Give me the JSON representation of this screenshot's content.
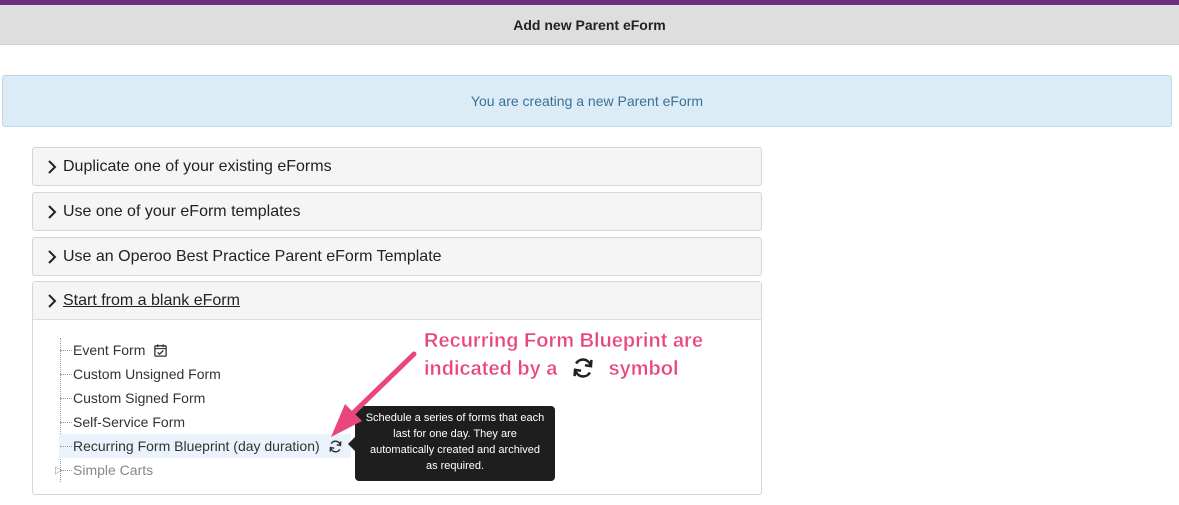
{
  "header": {
    "title": "Add new Parent eForm"
  },
  "info": {
    "text": "You are creating a new Parent eForm"
  },
  "panels": [
    {
      "label": "Duplicate one of your existing eForms"
    },
    {
      "label": "Use one of your eForm templates"
    },
    {
      "label": "Use an Operoo Best Practice Parent eForm Template"
    },
    {
      "label": "Start from a blank eForm"
    }
  ],
  "tree": {
    "items": [
      {
        "label": "Event Form",
        "icon": "calendar-check-icon"
      },
      {
        "label": "Custom Unsigned Form"
      },
      {
        "label": "Custom Signed Form"
      },
      {
        "label": "Self-Service Form"
      },
      {
        "label": "Recurring Form Blueprint (day duration)",
        "icon": "recurring-sync-icon"
      },
      {
        "label": "Simple Carts"
      }
    ]
  },
  "tooltip": {
    "text": "Schedule a series of forms that each last for one day. They are automatically created and archived as required."
  },
  "callout": {
    "line1": "Recurring Form Blueprint are",
    "line2_before": "indicated by a",
    "line2_after": "symbol",
    "icon": "recurring-sync-icon"
  },
  "colors": {
    "brand_stripe": "#6b2f7d",
    "callout": "#e8467c",
    "info_bg": "#dcecf6",
    "info_text": "#3c6f93"
  }
}
